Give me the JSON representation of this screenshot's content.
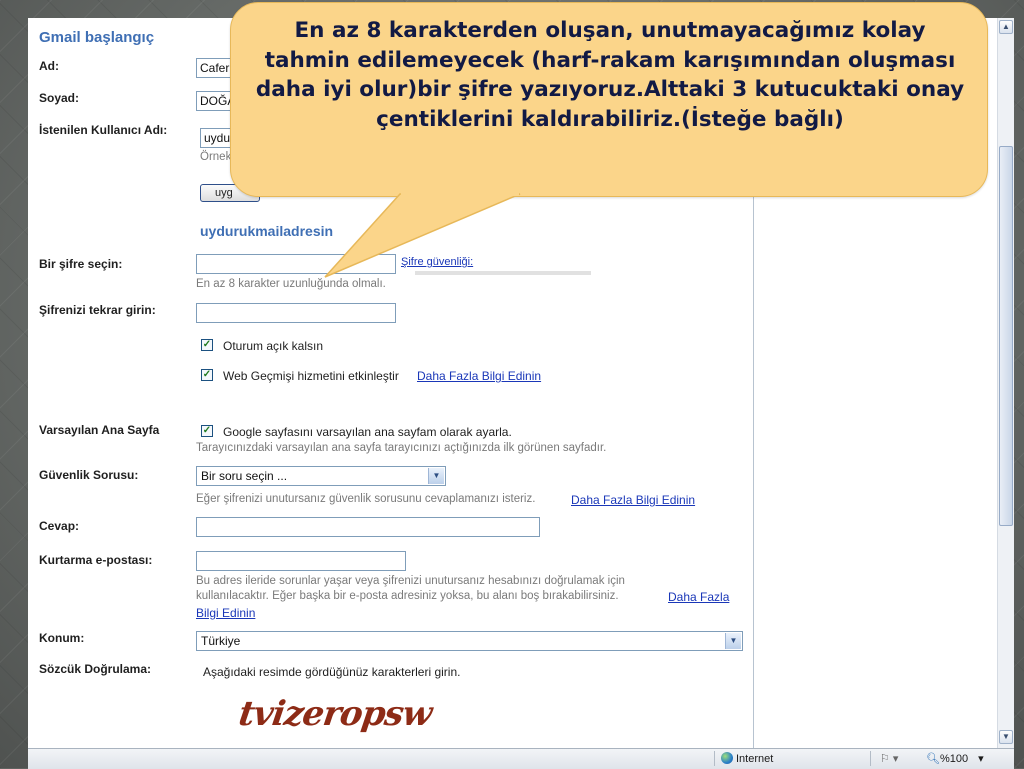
{
  "form": {
    "heading": "Gmail başlangıç",
    "first_name": {
      "label": "Ad:",
      "value": "Cafer"
    },
    "last_name": {
      "label": "Soyad:",
      "value": "DOĞA"
    },
    "username": {
      "label": "İstenilen Kullanıcı Adı:",
      "value": "uydu",
      "example": "Örnek"
    },
    "check_button_label": "uyg",
    "username_suggestion": "uydurukmailadresin",
    "password": {
      "label": "Bir şifre seçin:",
      "hint": "En az 8 karakter uzunluğunda olmalı.",
      "strength_link": "Şifre güvenliği:"
    },
    "password_confirm": {
      "label": "Şifrenizi tekrar girin:"
    },
    "stay_signed_in": {
      "label": "Oturum açık kalsın",
      "checked": true
    },
    "web_history": {
      "label": "Web Geçmişi hizmetini etkinleştir",
      "link": "Daha Fazla Bilgi Edinin",
      "checked": true
    },
    "default_homepage": {
      "label": "Varsayılan Ana Sayfa",
      "option": "Google sayfasını varsayılan ana sayfam olarak ayarla.",
      "hint": "Tarayıcınızdaki varsayılan ana sayfa tarayıcınızı açtığınızda ilk görünen sayfadır.",
      "checked": true
    },
    "security_question": {
      "label": "Güvenlik Sorusu:",
      "selected": "Bir soru seçin ...",
      "hint": "Eğer şifrenizi unutursanız güvenlik sorusunu cevaplamanızı isteriz.",
      "link": "Daha Fazla Bilgi Edinin"
    },
    "answer": {
      "label": "Cevap:"
    },
    "recovery_email": {
      "label": "Kurtarma e-postası:",
      "hint_line1": "Bu adres ileride sorunlar yaşar veya şifrenizi unutursanız hesabınızı doğrulamak için",
      "hint_line2": "kullanılacaktır. Eğer başka bir e-posta adresiniz yoksa, bu alanı boş bırakabilirsiniz.",
      "link_part1": "Daha Fazla",
      "link_part2": "Bilgi Edinin"
    },
    "location": {
      "label": "Konum:",
      "selected": "Türkiye"
    },
    "word_verification": {
      "label": "Sözcük Doğrulama:",
      "instruction": "Aşağıdaki resimde gördüğünüz karakterleri girin.",
      "captcha_text": "tvizeropsw"
    }
  },
  "callout": {
    "text": "En az 8 karakterden oluşan, unutmayacağımız kolay tahmin edilemeyecek (harf-rakam karışımından oluşması daha iyi olur)bir şifre yazıyoruz.Alttaki 3 kutucuktaki onay çentiklerini kaldırabiliriz.(İsteğe bağlı)",
    "color": "#fbd58a"
  },
  "status_bar": {
    "zone": "Internet",
    "zoom": "%100"
  }
}
